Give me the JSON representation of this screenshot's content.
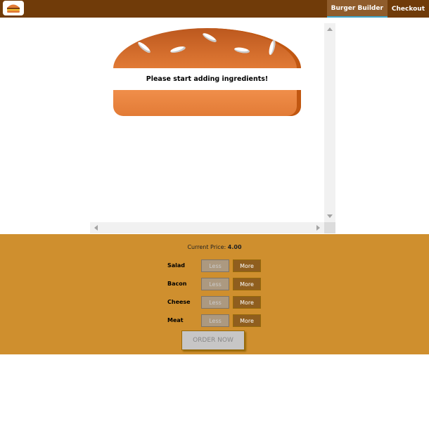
{
  "toolbar": {
    "logo_icon": "burger-logo-icon",
    "nav": [
      {
        "label": "Burger Builder",
        "active": true
      },
      {
        "label": "Checkout",
        "active": false
      }
    ]
  },
  "burger": {
    "placeholder": "Please start adding ingredients!"
  },
  "controls": {
    "price_label": "Current Price:",
    "price_value": "4.00",
    "rows": [
      {
        "label": "Salad",
        "less": "Less",
        "more": "More"
      },
      {
        "label": "Bacon",
        "less": "Less",
        "more": "More"
      },
      {
        "label": "Cheese",
        "less": "Less",
        "more": "More"
      },
      {
        "label": "Meat",
        "less": "Less",
        "more": "More"
      }
    ],
    "order_label": "ORDER NOW"
  },
  "colors": {
    "toolbar": "#703b09",
    "controls_bg": "#cf8f2e",
    "more_button": "#8f5e1e",
    "less_button_disabled": "#ac9980",
    "active_tab_underline": "#40a4c8"
  }
}
